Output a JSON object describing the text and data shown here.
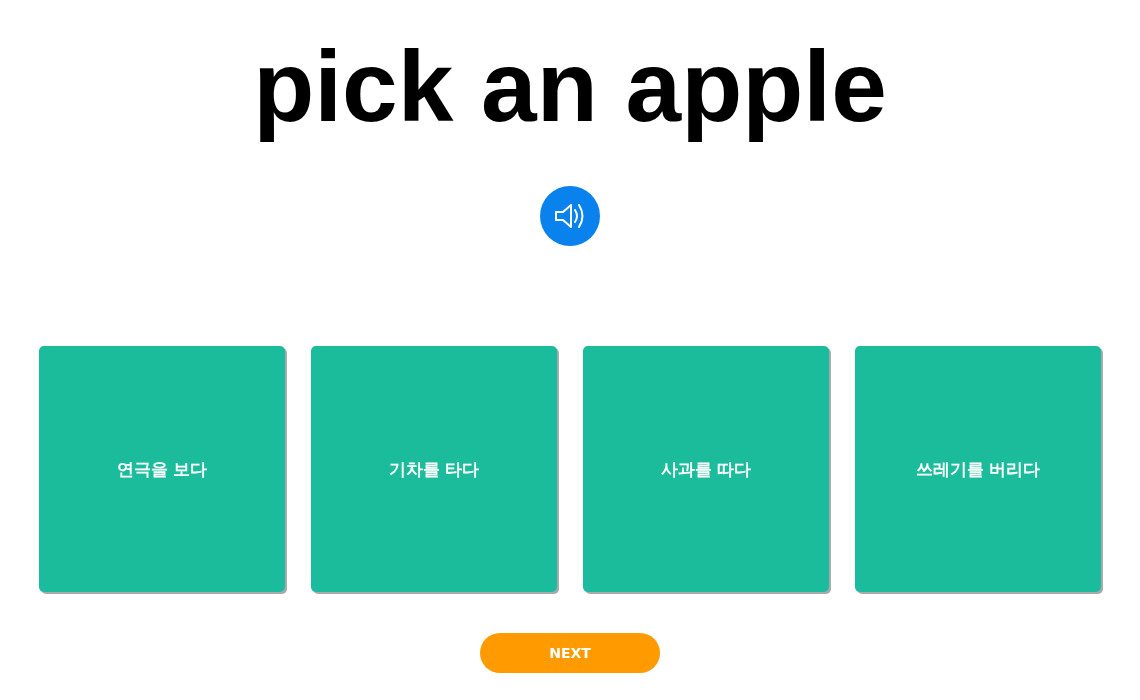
{
  "title": "pick an apple",
  "options": [
    {
      "label": "연극을 보다"
    },
    {
      "label": "기차를 타다"
    },
    {
      "label": "사과를 따다"
    },
    {
      "label": "쓰레기를 버리다"
    }
  ],
  "next_button": "NEXT"
}
